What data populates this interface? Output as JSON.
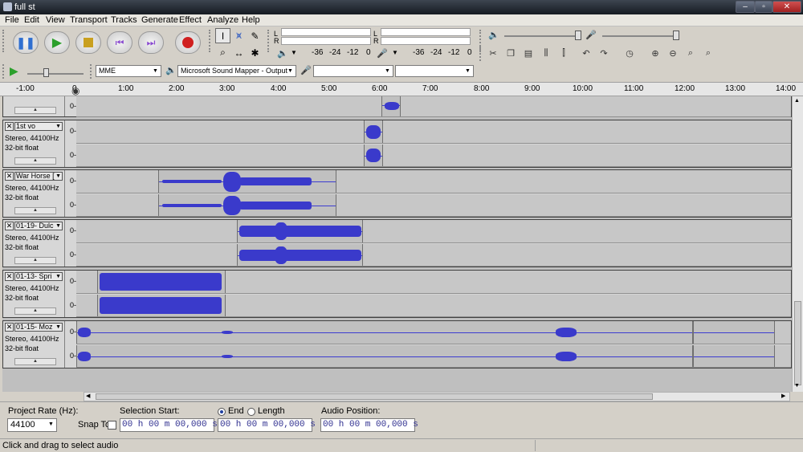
{
  "window": {
    "title": "full st"
  },
  "menu": [
    "File",
    "Edit",
    "View",
    "Transport",
    "Tracks",
    "Generate",
    "Effect",
    "Analyze",
    "Help"
  ],
  "meters": {
    "left_label": "L",
    "right_label": "R",
    "ticks": [
      "-36",
      "-24",
      "-12",
      "0"
    ]
  },
  "device": {
    "host": "MME",
    "output": "Microsoft Sound Mapper - Output",
    "input": "",
    "channels": ""
  },
  "ruler": [
    "-1:00",
    "0",
    "1:00",
    "2:00",
    "3:00",
    "4:00",
    "5:00",
    "6:00",
    "7:00",
    "8:00",
    "9:00",
    "10:00",
    "11:00",
    "12:00",
    "13:00",
    "14:00"
  ],
  "tracks": [
    {
      "name": "",
      "info1": "",
      "info2": "",
      "scale": [
        "0-"
      ]
    },
    {
      "name": "1st vo",
      "info1": "Stereo, 44100Hz",
      "info2": "32-bit float",
      "scale": [
        "0-",
        "0-"
      ]
    },
    {
      "name": "War Horse [",
      "info1": "Stereo, 44100Hz",
      "info2": "32-bit float",
      "scale": [
        "0-",
        "0-"
      ]
    },
    {
      "name": "01-19- Dulc",
      "info1": "Stereo, 44100Hz",
      "info2": "32-bit float",
      "scale": [
        "0-",
        "0-"
      ]
    },
    {
      "name": "01-13- Spri",
      "info1": "Stereo, 44100Hz",
      "info2": "32-bit float",
      "scale": [
        "0-",
        "0-"
      ]
    },
    {
      "name": "01-15- Moz",
      "info1": "Stereo, 44100Hz",
      "info2": "32-bit float",
      "scale": [
        "0-",
        "0-"
      ]
    }
  ],
  "selection_bar": {
    "rate_label": "Project Rate (Hz):",
    "rate_value": "44100",
    "snap_label": "Snap To",
    "sel_start_label": "Selection Start:",
    "end_label": "End",
    "length_label": "Length",
    "audio_pos_label": "Audio Position:",
    "time1": "00 h 00 m 00,000 s",
    "time2": "00 h 00 m 00,000 s",
    "time3": "00 h 00 m 00,000 s"
  },
  "status": "Click and drag to select audio",
  "colors": {
    "wave": "#3a3acb",
    "track_bg": "#c7c7c7"
  }
}
